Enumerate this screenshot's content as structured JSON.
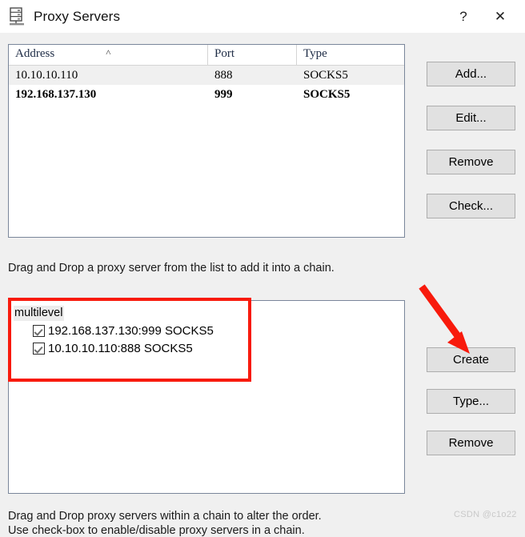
{
  "window": {
    "title": "Proxy Servers",
    "icon": "server-rack-icon",
    "help_label": "?",
    "close_label": "✕"
  },
  "server_list": {
    "columns": [
      "Address",
      "Port",
      "Type"
    ],
    "sort": {
      "column": "Address",
      "direction": "ascending",
      "glyph": "˄"
    },
    "rows": [
      {
        "address": "10.10.10.110",
        "port": "888",
        "type": "SOCKS5",
        "bold": false
      },
      {
        "address": "192.168.137.130",
        "port": "999",
        "type": "SOCKS5",
        "bold": true
      }
    ]
  },
  "list_buttons": {
    "add": "Add...",
    "edit": "Edit...",
    "remove": "Remove",
    "check": "Check..."
  },
  "hints": {
    "top": "Drag and Drop a proxy server from the list to add it into a chain.",
    "bottom1": "Drag and Drop proxy servers within a chain to alter the order.",
    "bottom2": "Use check-box to enable/disable proxy servers in a chain."
  },
  "chain": {
    "root_label": "multilevel",
    "items": [
      {
        "label": "192.168.137.130:999 SOCKS5",
        "checked": true
      },
      {
        "label": "10.10.10.110:888 SOCKS5",
        "checked": true
      }
    ]
  },
  "chain_buttons": {
    "create": "Create",
    "type": "Type...",
    "remove": "Remove"
  },
  "annotations": {
    "highlight_color": "#f81a0c",
    "arrow_color": "#f81a0c",
    "arrow_target": "Create"
  },
  "watermark": "CSDN @c1o22"
}
